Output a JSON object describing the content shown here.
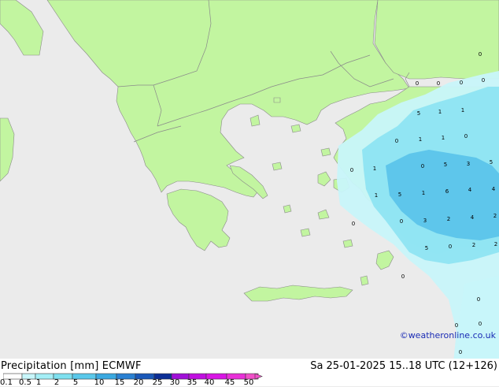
{
  "header": {
    "title": "Precipitation [mm]  ECMWF",
    "datetime": "Sa 25-01-2025 15..18 UTC (12+126)",
    "credit": "©weatheronline.co.uk"
  },
  "legend": {
    "labels": [
      "0.1",
      "0.5",
      "1",
      "2",
      "5",
      "10",
      "15",
      "20",
      "25",
      "30",
      "35",
      "40",
      "45",
      "50"
    ],
    "colors": [
      "#ffffff",
      "#c8f6fa",
      "#a4eef6",
      "#7ee0ef",
      "#5ac8ea",
      "#3aa8e0",
      "#2a80d2",
      "#1a58b8",
      "#0c2e96",
      "#a010d8",
      "#c010e0",
      "#d816e4",
      "#e830d8",
      "#f050c8"
    ]
  },
  "colors": {
    "sea": "#ebebeb",
    "land": "#c2f5a0",
    "border": "#8a8a8a",
    "precip_light": "#c8f6fa",
    "precip_mid": "#8ee4f2",
    "precip_heavy": "#5cc4ea"
  },
  "map": {
    "values": [
      {
        "t": "0"
      },
      {
        "t": "0"
      },
      {
        "t": "0"
      },
      {
        "t": "0"
      },
      {
        "t": "0"
      },
      {
        "t": "5"
      },
      {
        "t": "1"
      },
      {
        "t": "1"
      },
      {
        "t": "0"
      },
      {
        "t": "1"
      },
      {
        "t": "1"
      },
      {
        "t": "0"
      },
      {
        "t": "0"
      },
      {
        "t": "1"
      },
      {
        "t": "0"
      },
      {
        "t": "5"
      },
      {
        "t": "3"
      },
      {
        "t": "5"
      },
      {
        "t": "1"
      },
      {
        "t": "5"
      },
      {
        "t": "1"
      },
      {
        "t": "6"
      },
      {
        "t": "4"
      },
      {
        "t": "4"
      },
      {
        "t": "0"
      },
      {
        "t": "3"
      },
      {
        "t": "2"
      },
      {
        "t": "4"
      },
      {
        "t": "2"
      },
      {
        "t": "0"
      },
      {
        "t": "5"
      },
      {
        "t": "0"
      },
      {
        "t": "2"
      },
      {
        "t": "2"
      },
      {
        "t": "0"
      },
      {
        "t": "0"
      },
      {
        "t": "0"
      },
      {
        "t": "0"
      },
      {
        "t": "0"
      }
    ]
  }
}
